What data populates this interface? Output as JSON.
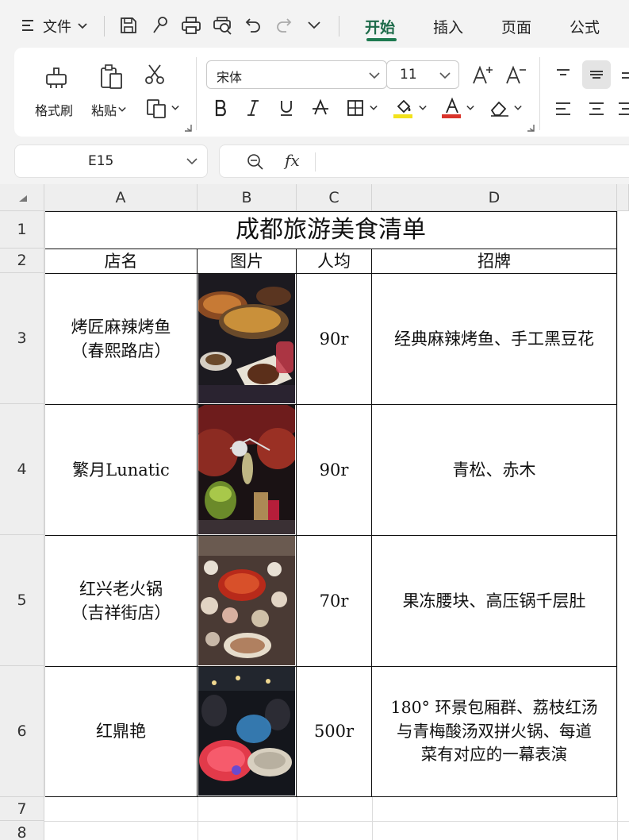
{
  "menu": {
    "file_label": "文件",
    "tabs": [
      "开始",
      "插入",
      "页面",
      "公式"
    ]
  },
  "ribbon": {
    "format_painter": "格式刷",
    "paste": "粘贴",
    "font_name": "宋体",
    "font_size": "11"
  },
  "formula_bar": {
    "cell_ref": "E15",
    "fx": "fx"
  },
  "sheet": {
    "columns": [
      "A",
      "B",
      "C",
      "D"
    ],
    "rows": [
      "1",
      "2",
      "3",
      "4",
      "5",
      "6",
      "7",
      "8"
    ],
    "title": "成都旅游美食清单",
    "headers": [
      "店名",
      "图片",
      "人均",
      "招牌"
    ],
    "records": [
      {
        "name_line1": "烤匠麻辣烤鱼",
        "name_line2": "（春熙路店）",
        "price": "90r",
        "signature_lines": [
          "经典麻辣烤鱼、手工黑豆花"
        ]
      },
      {
        "name_line1": "繁月Lunatic",
        "name_line2": "",
        "price": "90r",
        "signature_lines": [
          "青松、赤木"
        ]
      },
      {
        "name_line1": "红兴老火锅",
        "name_line2": "（吉祥街店）",
        "price": "70r",
        "signature_lines": [
          "果冻腰块、高压锅千层肚"
        ]
      },
      {
        "name_line1": "红鼎艳",
        "name_line2": "",
        "price": "500r",
        "signature_lines": [
          "180° 环景包厢群、荔枝红汤",
          "与青梅酸汤双拼火锅、每道",
          "菜有对应的一幕表演"
        ]
      }
    ]
  },
  "colors": {
    "accent": "#1e7a50",
    "font_color_bar": "#d9342b",
    "fill_color_bar": "#f2e21b"
  }
}
